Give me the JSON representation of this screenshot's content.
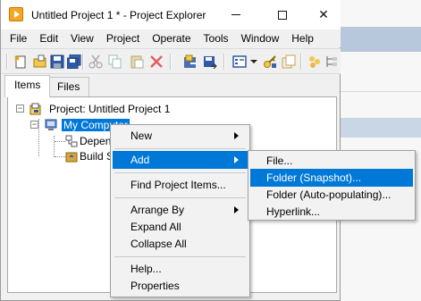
{
  "window": {
    "title": "Untitled Project 1 * - Project Explorer",
    "close_glyph": "✕"
  },
  "menubar": [
    "File",
    "Edit",
    "View",
    "Project",
    "Operate",
    "Tools",
    "Window",
    "Help"
  ],
  "toolbar": {
    "icons": [
      "new-icon",
      "open-icon",
      "save-icon",
      "save-all-icon",
      "cut-icon",
      "copy-icon",
      "paste-icon",
      "delete-icon",
      "build-icon",
      "deploy-icon",
      "view-options-icon",
      "dropdown-icon",
      "key-icon",
      "add-file-icon",
      "properties-icon",
      "tree-icon"
    ]
  },
  "tabs": {
    "items": "Items",
    "files": "Files"
  },
  "tree": {
    "project": "Project: Untitled Project 1",
    "computer": "My Computer",
    "dependencies": "Depen",
    "build_specs": "Build S"
  },
  "context_menu": {
    "new": "New",
    "add": "Add",
    "find": "Find Project Items...",
    "arrange": "Arrange By",
    "expand": "Expand All",
    "collapse": "Collapse All",
    "help": "Help...",
    "properties": "Properties"
  },
  "submenu": {
    "file": "File...",
    "folder_snapshot": "Folder (Snapshot)...",
    "folder_auto": "Folder (Auto-populating)...",
    "hyperlink": "Hyperlink..."
  },
  "colors": {
    "selection": "#0078d7",
    "accent": "#f6a623"
  }
}
